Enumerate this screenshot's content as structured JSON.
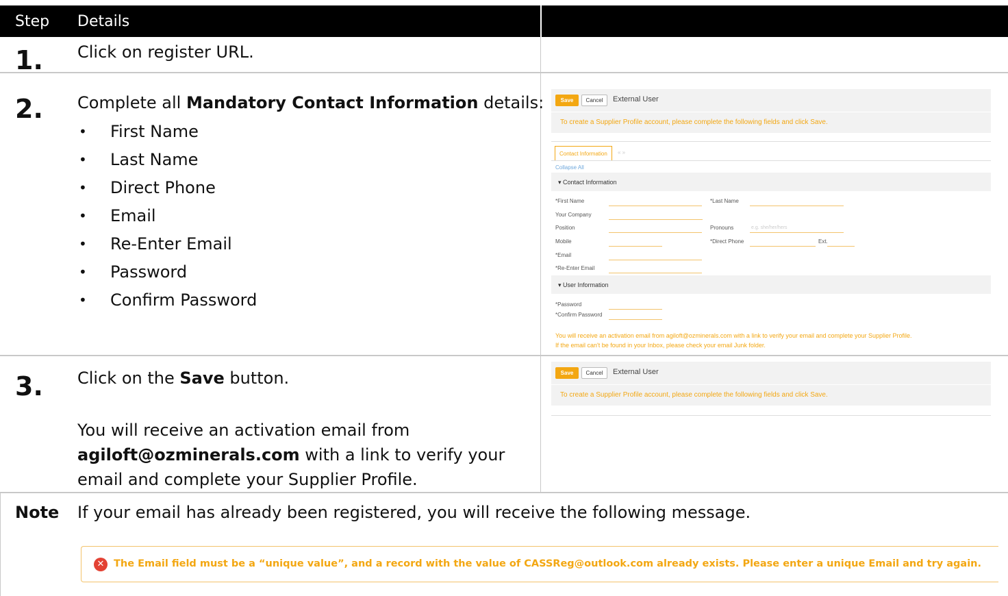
{
  "table": {
    "header": {
      "step": "Step",
      "details": "Details"
    },
    "rows": [
      {
        "step": "1.",
        "text": "Click on register URL."
      },
      {
        "step": "2.",
        "intro_pre": "Complete all ",
        "intro_bold": "Mandatory Contact Information",
        "intro_post": " details:",
        "bullets": [
          "First Name",
          "Last Name",
          "Direct Phone",
          "Email",
          "Re-Enter Email",
          "Password",
          "Confirm Password"
        ]
      },
      {
        "step": "3.",
        "text_pre": "Click on the ",
        "text_bold": "Save",
        "text_post": " button.",
        "para_pre": "You will receive an activation email from",
        "para_email": "agiloft@ozminerals.com",
        "para_mid": " with a link to verify your",
        "para_end": "email and complete your Supplier Profile."
      }
    ],
    "note": {
      "label": "Note",
      "text": "If your email has already been registered, you will receive the following message."
    }
  },
  "form_screenshot": {
    "save_label": "Save",
    "cancel_label": "Cancel",
    "title": "External User",
    "notice": "To create a Supplier Profile account, please complete the following fields and click Save.",
    "tab_label": "Contact Information",
    "tab_arrows": "« »",
    "collapse_all": "Collapse All",
    "section_contact": "▾ Contact Information",
    "section_user": "▾ User Information",
    "fields": {
      "first_name": "*First Name",
      "last_name": "*Last Name",
      "your_company": "Your Company",
      "position": "Position",
      "pronouns": "Pronouns",
      "pronouns_placeholder": "e.g. she/her/hers",
      "mobile": "Mobile",
      "direct_phone": "*Direct Phone",
      "ext": "Ext.",
      "email": "*Email",
      "reenter_email": "*Re-Enter Email",
      "password": "*Password",
      "confirm_password": "*Confirm Password"
    },
    "activation_line1": "You will receive an activation email from agiloft@ozminerals.com with a link to verify your email and complete your Supplier Profile.",
    "activation_line2": "If the email can't be found in your Inbox, please check your email Junk folder."
  },
  "error_message": {
    "icon": "error-x-icon",
    "text": "The Email field must be a “unique value”, and a record with the value of CASSReg@outlook.com already exists. Please enter a unique Email and try again."
  },
  "colors": {
    "accent": "#f3a712",
    "header_bg": "#000000",
    "error_icon": "#e34234"
  }
}
